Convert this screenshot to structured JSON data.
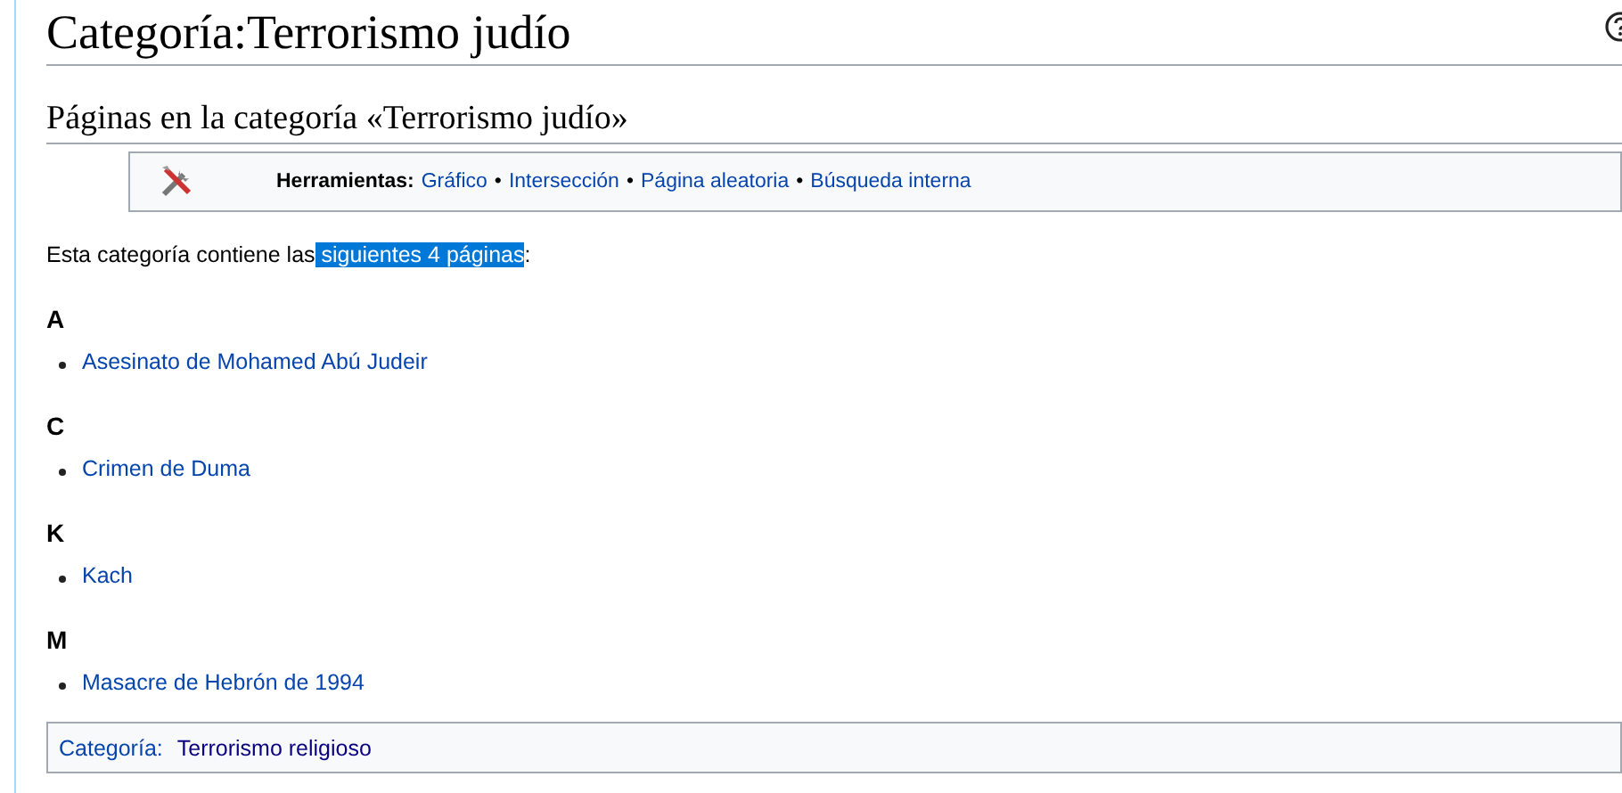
{
  "title": "Categoría:Terrorismo judío",
  "subtitle": "Páginas en la categoría «Terrorismo judío»",
  "tools": {
    "label": "Herramientas:",
    "links": [
      "Gráfico",
      "Intersección",
      "Página aleatoria",
      "Búsqueda interna"
    ],
    "separator": "•"
  },
  "summary": {
    "text": "Esta categoría contiene las",
    "link": " siguientes 4 páginas",
    "link_highlighted": true,
    "after": ":"
  },
  "sections": [
    {
      "letter": "A",
      "items": [
        "Asesinato de Mohamed Abú Judeir"
      ]
    },
    {
      "letter": "C",
      "items": [
        "Crimen de Duma"
      ]
    },
    {
      "letter": "K",
      "items": [
        "Kach"
      ]
    },
    {
      "letter": "M",
      "items": [
        "Masacre de Hebrón de 1994"
      ]
    }
  ],
  "catlinks": {
    "label": "Categoría:",
    "links": [
      "Terrorismo religioso"
    ]
  }
}
